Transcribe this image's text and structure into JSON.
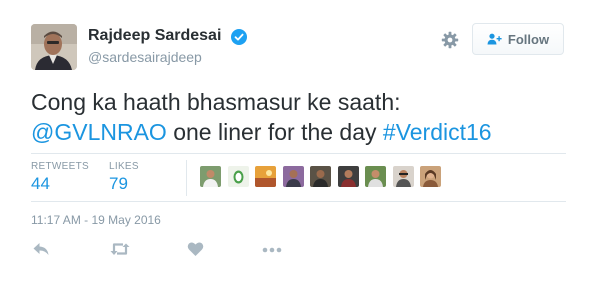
{
  "user": {
    "name": "Rajdeep Sardesai",
    "handle": "@sardesairajdeep"
  },
  "follow_button": {
    "label": "Follow"
  },
  "tweet": {
    "text_line1": "Cong ka haath bhasmasur ke saath:",
    "mention": "@GVLNRAO",
    "text_middle": " one liner for the day ",
    "hashtag": "#Verdict16"
  },
  "stats": {
    "retweets_label": "RETWEETS",
    "retweets_value": "44",
    "likes_label": "LIKES",
    "likes_value": "79"
  },
  "timestamp": "11:17 AM - 19 May 2016",
  "colors": {
    "link": "#1b95e0",
    "verified": "#1da1f2",
    "muted": "#8899a6"
  },
  "icons": [
    "verified-badge-icon",
    "gear-icon",
    "follow-person-icon",
    "reply-icon",
    "retweet-icon",
    "like-heart-icon",
    "more-icon"
  ]
}
